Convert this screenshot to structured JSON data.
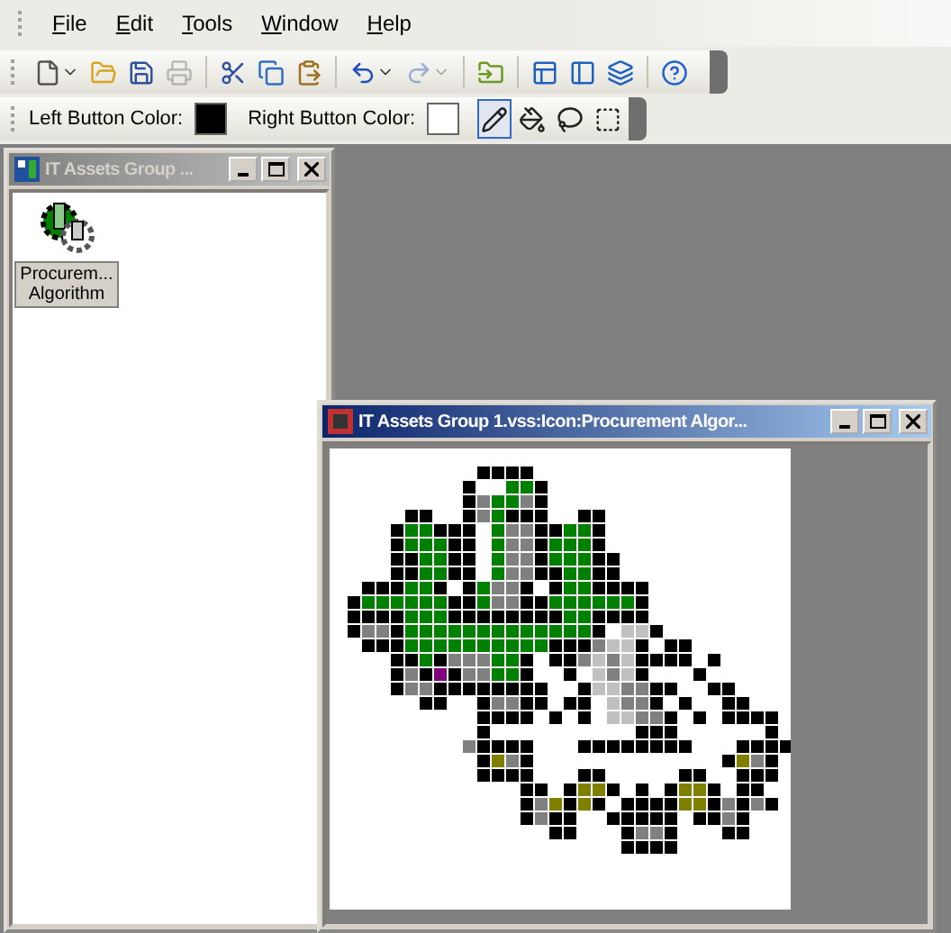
{
  "menu": [
    {
      "label": "File"
    },
    {
      "label": "Edit"
    },
    {
      "label": "Tools"
    },
    {
      "label": "Window"
    },
    {
      "label": "Help"
    }
  ],
  "standard_toolbar": {
    "groups": [
      [
        {
          "disabled": false,
          "dropdown": true
        },
        {
          "disabled": false,
          "dropdown": false
        },
        {
          "disabled": false,
          "dropdown": false
        },
        {
          "disabled": true,
          "dropdown": false
        }
      ],
      [
        {
          "disabled": false,
          "dropdown": false
        },
        {
          "disabled": false,
          "dropdown": false
        },
        {
          "disabled": false,
          "dropdown": false
        }
      ],
      [
        {
          "disabled": false,
          "dropdown": true
        },
        {
          "disabled": true,
          "dropdown": true
        }
      ],
      [
        {
          "disabled": false,
          "dropdown": false
        }
      ],
      [
        {
          "disabled": false,
          "dropdown": false
        },
        {
          "disabled": false,
          "dropdown": false
        },
        {
          "disabled": false,
          "dropdown": false
        }
      ],
      [
        {
          "disabled": false,
          "dropdown": false
        }
      ]
    ]
  },
  "color_toolbar": {
    "left": {
      "label": "Left Button Color:",
      "color": "#000000"
    },
    "right": {
      "label": "Right Button Color:",
      "color": "#ffffff"
    },
    "tools": [
      {
        "selected": true
      },
      {
        "selected": false
      },
      {
        "selected": false
      },
      {
        "selected": false
      }
    ]
  },
  "palette_window": {
    "title": "IT Assets Group ...",
    "active": false,
    "items": [
      {
        "lines": [
          "Procurem...",
          "Algorithm"
        ],
        "selected": true
      }
    ]
  },
  "editor_window": {
    "title": "IT Assets Group 1.vss:Icon:Procurement Algor...",
    "active": true
  }
}
